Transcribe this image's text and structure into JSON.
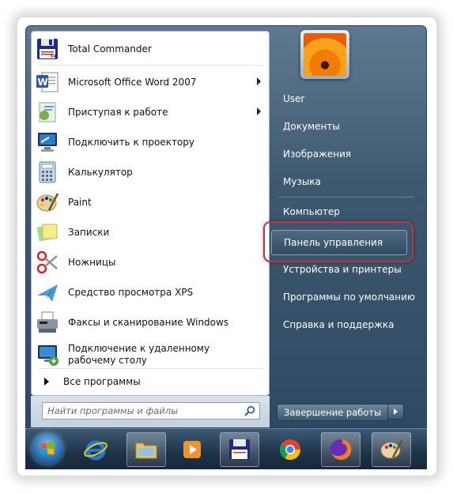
{
  "left_pane": {
    "programs": [
      {
        "name": "total-commander",
        "label": "Total Commander",
        "has_arrow": false,
        "icon": "floppy-disk-icon"
      },
      {
        "name": "word-2007",
        "label": "Microsoft Office Word 2007",
        "has_arrow": true,
        "icon": "word-icon"
      },
      {
        "name": "getting-started",
        "label": "Приступая к работе",
        "has_arrow": true,
        "icon": "getting-started-icon"
      },
      {
        "name": "projector",
        "label": "Подключить к проектору",
        "has_arrow": false,
        "icon": "projector-icon"
      },
      {
        "name": "calculator",
        "label": "Калькулятор",
        "has_arrow": false,
        "icon": "calculator-icon"
      },
      {
        "name": "paint",
        "label": "Paint",
        "has_arrow": false,
        "icon": "paint-palette-icon"
      },
      {
        "name": "sticky-notes",
        "label": "Записки",
        "has_arrow": false,
        "icon": "sticky-notes-icon"
      },
      {
        "name": "snipping-tool",
        "label": "Ножницы",
        "has_arrow": false,
        "icon": "scissors-icon"
      },
      {
        "name": "xps-viewer",
        "label": "Средство просмотра XPS",
        "has_arrow": false,
        "icon": "xps-icon"
      },
      {
        "name": "fax-scan",
        "label": "Факсы и сканирование Windows",
        "has_arrow": false,
        "icon": "fax-icon"
      },
      {
        "name": "remote-desktop",
        "label": "Подключение к удаленному рабочему столу",
        "has_arrow": false,
        "icon": "remote-desktop-icon"
      }
    ],
    "all_programs": "Все программы",
    "search_placeholder": "Найти программы и файлы"
  },
  "right_pane": {
    "items": [
      {
        "name": "user",
        "label": "User"
      },
      {
        "name": "documents",
        "label": "Документы"
      },
      {
        "name": "pictures",
        "label": "Изображения"
      },
      {
        "name": "music",
        "label": "Музыка"
      },
      {
        "name": "computer",
        "label": "Компьютер"
      },
      {
        "name": "control-panel",
        "label": "Панель управления"
      },
      {
        "name": "devices-printers",
        "label": "Устройства и принтеры"
      },
      {
        "name": "default-programs",
        "label": "Программы по умолчанию"
      },
      {
        "name": "help-support",
        "label": "Справка и поддержка"
      }
    ],
    "highlighted": "Панель управления",
    "shutdown_label": "Завершение работы"
  },
  "taskbar": {
    "items": [
      "start-orb-icon",
      "internet-explorer-icon",
      "explorer-folder-icon",
      "media-player-icon",
      "total-commander-icon",
      "chrome-icon",
      "firefox-icon",
      "paint-icon"
    ]
  },
  "colors": {
    "highlight_ring": "#c4333b",
    "menu_dark": "#2e4a62"
  }
}
